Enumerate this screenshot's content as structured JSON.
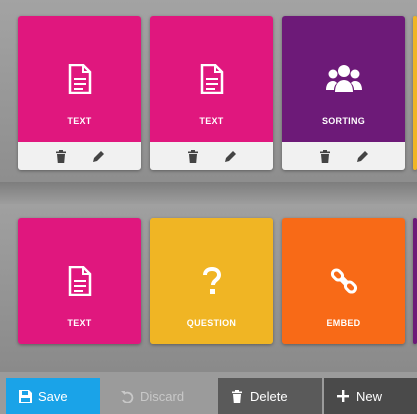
{
  "colors": {
    "magenta": "#e0177e",
    "purple": "#6d1a78",
    "yellow": "#f0b524",
    "orange": "#f86a17",
    "save_blue": "#1aa3e8"
  },
  "top_row": [
    {
      "label": "TEXT",
      "icon": "document-icon",
      "color": "#e0177e"
    },
    {
      "label": "TEXT",
      "icon": "document-icon",
      "color": "#e0177e"
    },
    {
      "label": "SORTING",
      "icon": "group-icon",
      "color": "#6d1a78"
    }
  ],
  "bottom_row": [
    {
      "label": "TEXT",
      "icon": "document-icon",
      "color": "#e0177e"
    },
    {
      "label": "QUESTION",
      "icon": "question-icon",
      "color": "#f0b524"
    },
    {
      "label": "EMBED",
      "icon": "link-icon",
      "color": "#f86a17"
    }
  ],
  "toolbar": {
    "save": "Save",
    "discard": "Discard",
    "delete": "Delete",
    "new": "New"
  }
}
